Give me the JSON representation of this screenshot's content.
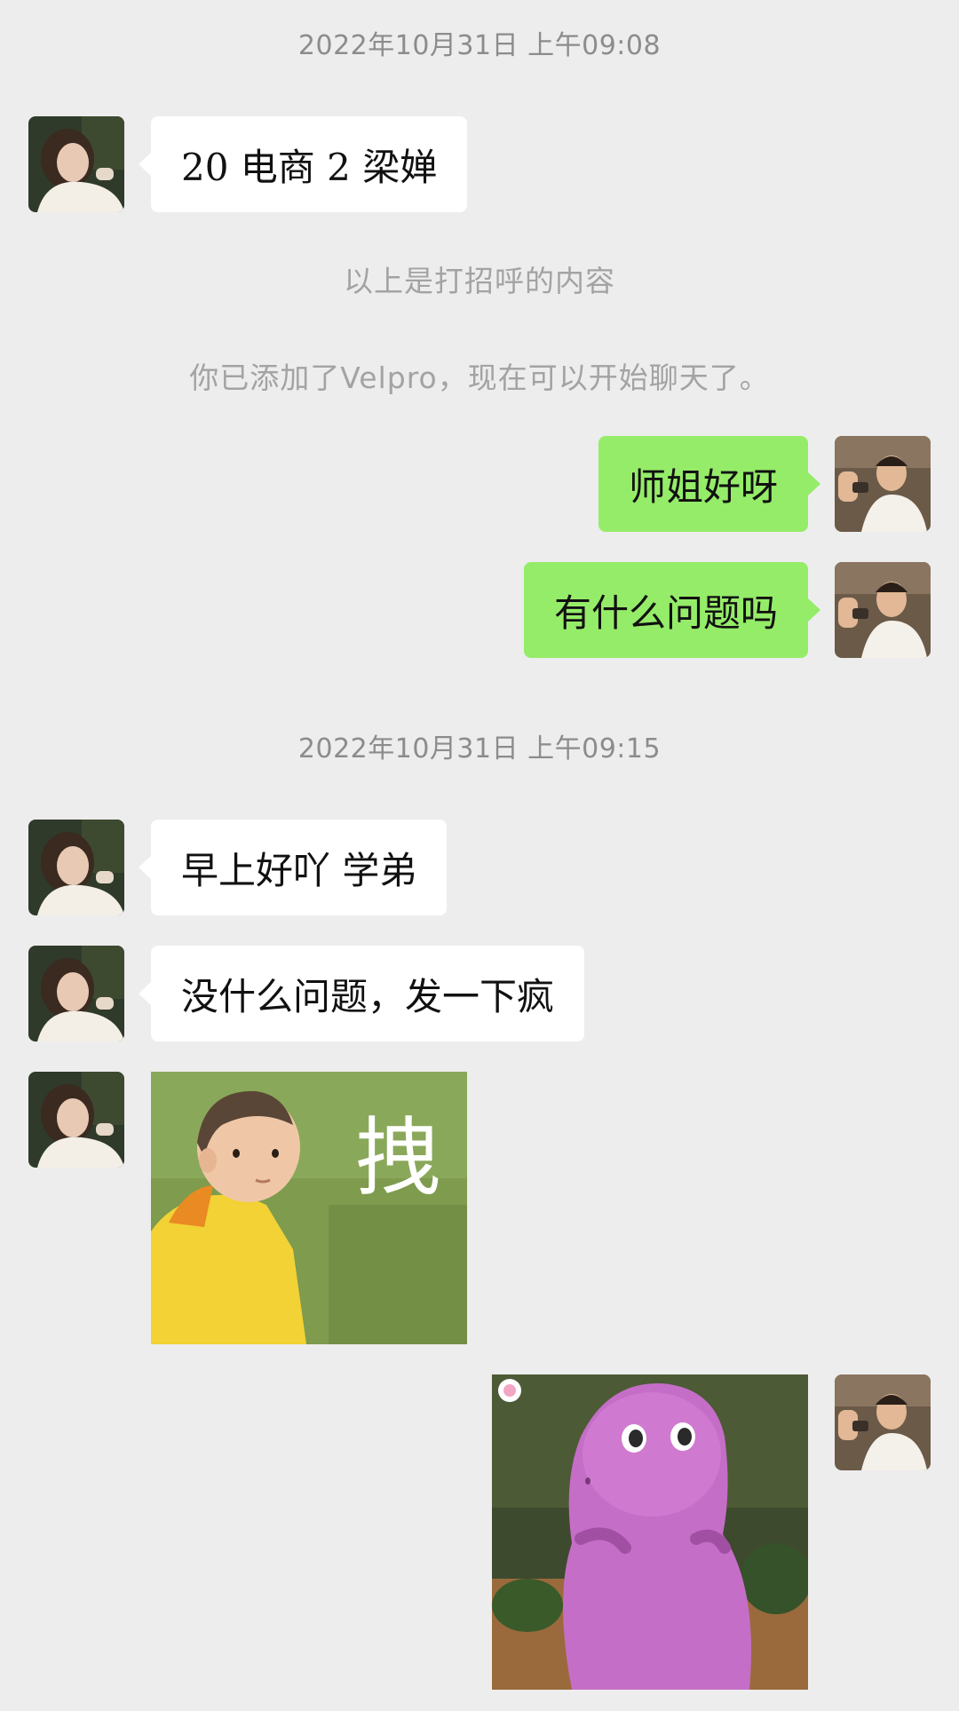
{
  "chat": {
    "timestamps": [
      "2022年10月31日 上午09:08",
      "2022年10月31日 上午09:15"
    ],
    "system_messages": [
      "以上是打招呼的内容",
      "你已添加了Velpro，现在可以开始聊天了。"
    ],
    "messages": [
      {
        "sender": "other",
        "text": "20 电商 2 梁婵"
      },
      {
        "sender": "self",
        "text": "师姐好呀"
      },
      {
        "sender": "self",
        "text": "有什么问题吗"
      },
      {
        "sender": "other",
        "text": "早上好吖 学弟"
      },
      {
        "sender": "other",
        "text": "没什么问题，发一下疯"
      },
      {
        "sender": "other",
        "type": "sticker",
        "sticker": "baby-in-yellow-raincoat",
        "caption": "拽"
      },
      {
        "sender": "self",
        "type": "sticker",
        "sticker": "purple-dinosaur"
      }
    ]
  },
  "icons": {
    "other_avatar": "girl-avatar-icon",
    "self_avatar": "boy-avatar-icon"
  },
  "colors": {
    "background": "#ededed",
    "self_bubble": "#95ec69",
    "other_bubble": "#ffffff",
    "timestamp_text": "#8c8c8c"
  }
}
